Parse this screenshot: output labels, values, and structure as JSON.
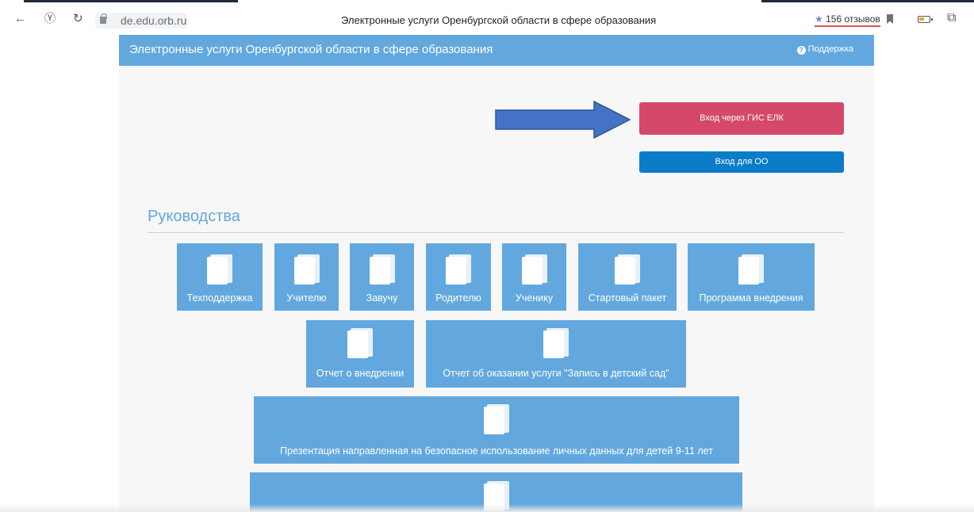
{
  "browser": {
    "url": "de.edu.orb.ru",
    "tab_title": "Электронные услуги Оренбургской области в сфере образования",
    "reviews": "156 отзывов",
    "star": "★",
    "icons": [
      "back-icon",
      "yandex-icon",
      "reload-icon",
      "lock-icon",
      "bookmark-icon",
      "battery-icon",
      "extension-icon"
    ]
  },
  "header": {
    "title": "Электронные услуги Оренбургской области в сфере образования",
    "support_label": "Поддержка"
  },
  "auth": {
    "gis_button": "Вход через ГИС ЕЛК",
    "oo_button": "Вход для ОО"
  },
  "guides": {
    "title": "Руководства",
    "tiles": [
      "Техподдержка",
      "Учителю",
      "Завучу",
      "Родителю",
      "Ученику",
      "Стартовый пакет",
      "Программа внедрения",
      "Отчет о внедрении",
      "Отчет об оказании услуги \"Запись в детский сад\"",
      "Презентация направленная на безопасное использование личных данных для детей 9-11 лет",
      ""
    ]
  },
  "colors": {
    "header": "#62a8de",
    "gis_button": "#d4496a",
    "oo_button": "#0a7cc8",
    "arrow": "#4472c4"
  }
}
